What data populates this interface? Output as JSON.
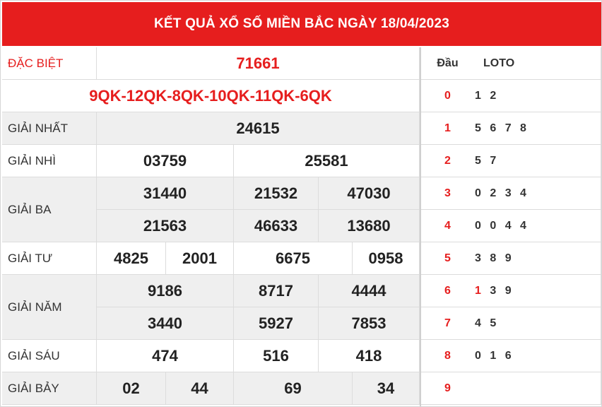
{
  "title": "KẾT QUẢ XỔ SỐ MIỀN BẮC NGÀY 18/04/2023",
  "prizes": {
    "db_label": "ĐẶC BIỆT",
    "db_value": "71661",
    "code": "9QK-12QK-8QK-10QK-11QK-6QK",
    "g1_label": "GIẢI NHẤT",
    "g1": [
      "24615"
    ],
    "g2_label": "GIẢI NHÌ",
    "g2": [
      "03759",
      "25581"
    ],
    "g3_label": "GIẢI BA",
    "g3": [
      "31440",
      "21532",
      "47030",
      "21563",
      "46633",
      "13680"
    ],
    "g4_label": "GIẢI TƯ",
    "g4": [
      "4825",
      "2001",
      "6675",
      "0958"
    ],
    "g5_label": "GIẢI NĂM",
    "g5": [
      "9186",
      "8717",
      "4444",
      "3440",
      "5927",
      "7853"
    ],
    "g6_label": "GIẢI SÁU",
    "g6": [
      "474",
      "516",
      "418"
    ],
    "g7_label": "GIẢI BẢY",
    "g7": [
      "02",
      "44",
      "69",
      "34"
    ]
  },
  "loto_table": {
    "head_label": "Đầu",
    "loto_label": "LOTO",
    "rows": [
      {
        "dau": "0",
        "loto": "1 2"
      },
      {
        "dau": "1",
        "loto": "5 6 7 8"
      },
      {
        "dau": "2",
        "loto": "5 7"
      },
      {
        "dau": "3",
        "loto": "0 2 3 4"
      },
      {
        "dau": "4",
        "loto": "0 0 4 4"
      },
      {
        "dau": "5",
        "loto": "3 8 9"
      },
      {
        "dau": "6",
        "loto_highlight": "1",
        "loto_rest": " 3 9"
      },
      {
        "dau": "7",
        "loto": "4 5"
      },
      {
        "dau": "8",
        "loto": "0 1 6"
      },
      {
        "dau": "9",
        "loto": ""
      }
    ]
  },
  "colors": {
    "accent_red": "#e61e1e",
    "row_gray": "#efefef",
    "text_dark": "#222222"
  }
}
